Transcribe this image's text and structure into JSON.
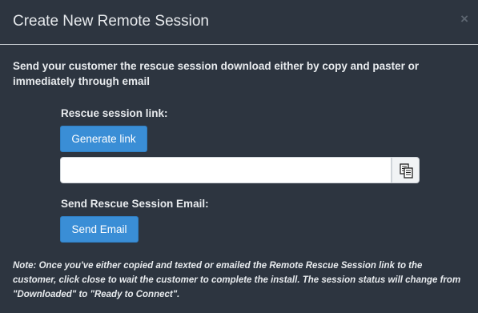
{
  "modal": {
    "title": "Create New Remote Session",
    "close_glyph": "×"
  },
  "intro_text": "Send your customer the rescue session download either by copy and paster or immediately through email",
  "link_section": {
    "label": "Rescue session link:",
    "generate_label": "Generate link",
    "link_value": "",
    "link_placeholder": "",
    "copy_icon": "copy-icon"
  },
  "email_section": {
    "label": "Send Rescue Session Email:",
    "send_label": "Send Email"
  },
  "note": "Note: Once you've either copied and texted or emailed the Remote Rescue Session link to the customer, click close to wait the customer to complete the install. The session status will change from \"Downloaded\" to \"Ready to Connect\".",
  "colors": {
    "background": "#2d3540",
    "primary_button": "#3a8ed6",
    "text": "#e8ebee"
  }
}
